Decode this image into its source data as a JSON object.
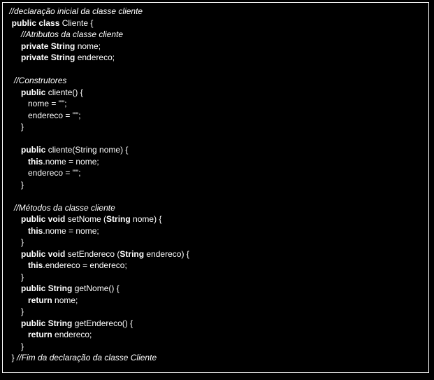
{
  "code": {
    "lines": [
      [
        {
          "t": " //declaração inicial da classe cliente",
          "c": "cm"
        }
      ],
      [
        {
          "t": "  ",
          "c": "pl"
        },
        {
          "t": "public class",
          "c": "kw"
        },
        {
          "t": " Cliente {",
          "c": "pl"
        }
      ],
      [
        {
          "t": "      //Atributos da classe cliente",
          "c": "cm"
        }
      ],
      [
        {
          "t": "      ",
          "c": "pl"
        },
        {
          "t": "private String",
          "c": "kw"
        },
        {
          "t": " nome;",
          "c": "pl"
        }
      ],
      [
        {
          "t": "      ",
          "c": "pl"
        },
        {
          "t": "private String",
          "c": "kw"
        },
        {
          "t": " endereco;",
          "c": "pl"
        }
      ],
      [
        {
          "t": "",
          "c": "pl"
        }
      ],
      [
        {
          "t": "   //Construtores",
          "c": "cm"
        }
      ],
      [
        {
          "t": "      ",
          "c": "pl"
        },
        {
          "t": "public",
          "c": "kw"
        },
        {
          "t": " cliente() {",
          "c": "pl"
        }
      ],
      [
        {
          "t": "         nome = \"\";",
          "c": "pl"
        }
      ],
      [
        {
          "t": "         endereco = \"\";",
          "c": "pl"
        }
      ],
      [
        {
          "t": "      }",
          "c": "pl"
        }
      ],
      [
        {
          "t": "",
          "c": "pl"
        }
      ],
      [
        {
          "t": "      ",
          "c": "pl"
        },
        {
          "t": "public",
          "c": "kw"
        },
        {
          "t": " cliente(String nome) {",
          "c": "pl"
        }
      ],
      [
        {
          "t": "         ",
          "c": "pl"
        },
        {
          "t": "this",
          "c": "kw"
        },
        {
          "t": ".nome = nome;",
          "c": "pl"
        }
      ],
      [
        {
          "t": "         endereco = \"\";",
          "c": "pl"
        }
      ],
      [
        {
          "t": "      }",
          "c": "pl"
        }
      ],
      [
        {
          "t": "",
          "c": "pl"
        }
      ],
      [
        {
          "t": "   //Métodos da classe cliente",
          "c": "cm"
        }
      ],
      [
        {
          "t": "      ",
          "c": "pl"
        },
        {
          "t": "public void",
          "c": "kw"
        },
        {
          "t": " setNome (",
          "c": "pl"
        },
        {
          "t": "String",
          "c": "kw"
        },
        {
          "t": " nome) {",
          "c": "pl"
        }
      ],
      [
        {
          "t": "         ",
          "c": "pl"
        },
        {
          "t": "this",
          "c": "kw"
        },
        {
          "t": ".nome = nome;",
          "c": "pl"
        }
      ],
      [
        {
          "t": "      }",
          "c": "pl"
        }
      ],
      [
        {
          "t": "      ",
          "c": "pl"
        },
        {
          "t": "public void",
          "c": "kw"
        },
        {
          "t": " setEndereco (",
          "c": "pl"
        },
        {
          "t": "String",
          "c": "kw"
        },
        {
          "t": " endereco) {",
          "c": "pl"
        }
      ],
      [
        {
          "t": "         ",
          "c": "pl"
        },
        {
          "t": "this",
          "c": "kw"
        },
        {
          "t": ".endereco = endereco;",
          "c": "pl"
        }
      ],
      [
        {
          "t": "      }",
          "c": "pl"
        }
      ],
      [
        {
          "t": "      ",
          "c": "pl"
        },
        {
          "t": "public String",
          "c": "kw"
        },
        {
          "t": " getNome() {",
          "c": "pl"
        }
      ],
      [
        {
          "t": "         ",
          "c": "pl"
        },
        {
          "t": "return",
          "c": "kw"
        },
        {
          "t": " nome;",
          "c": "pl"
        }
      ],
      [
        {
          "t": "      }",
          "c": "pl"
        }
      ],
      [
        {
          "t": "      ",
          "c": "pl"
        },
        {
          "t": "public String",
          "c": "kw"
        },
        {
          "t": " getEndereco() {",
          "c": "pl"
        }
      ],
      [
        {
          "t": "         ",
          "c": "pl"
        },
        {
          "t": "return",
          "c": "kw"
        },
        {
          "t": " endereco;",
          "c": "pl"
        }
      ],
      [
        {
          "t": "      }",
          "c": "pl"
        }
      ],
      [
        {
          "t": "  } ",
          "c": "pl"
        },
        {
          "t": "//Fim da declaração da classe Cliente",
          "c": "cm"
        }
      ]
    ]
  }
}
